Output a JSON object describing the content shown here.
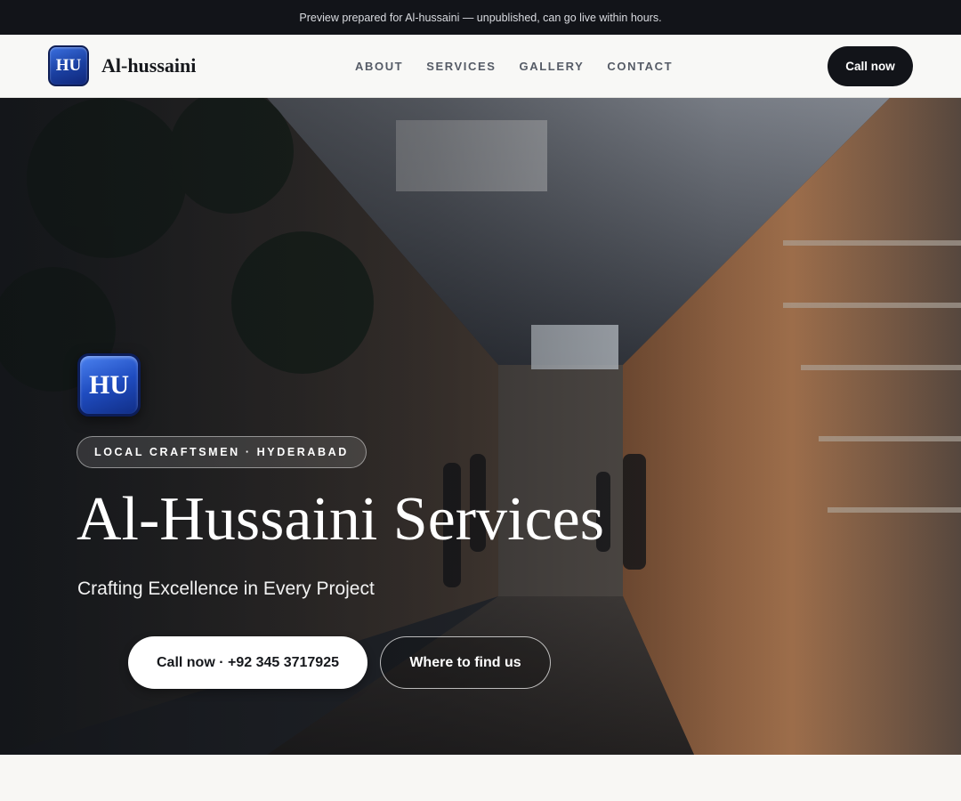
{
  "banner": {
    "text": "Preview prepared for Al-hussaini — unpublished, can go live within hours."
  },
  "nav": {
    "logo_text": "HU",
    "brand_name": "Al-hussaini",
    "links": [
      {
        "label": "ABOUT"
      },
      {
        "label": "SERVICES"
      },
      {
        "label": "GALLERY"
      },
      {
        "label": "CONTACT"
      }
    ],
    "cta_label": "Call now"
  },
  "hero": {
    "logo_text": "HU",
    "eyebrow": "LOCAL CRAFTSMEN · HYDERABAD",
    "title": "Al-Hussaini Services",
    "subtitle": "Crafting Excellence in Every Project",
    "primary_button": "Call now · +92 345 3717925",
    "secondary_button": "Where to find us",
    "background_image": "market-alley-photo"
  },
  "colors": {
    "dark": "#121419",
    "logo_blue": "#1f4cc0",
    "page_bg": "#f8f7f4"
  }
}
